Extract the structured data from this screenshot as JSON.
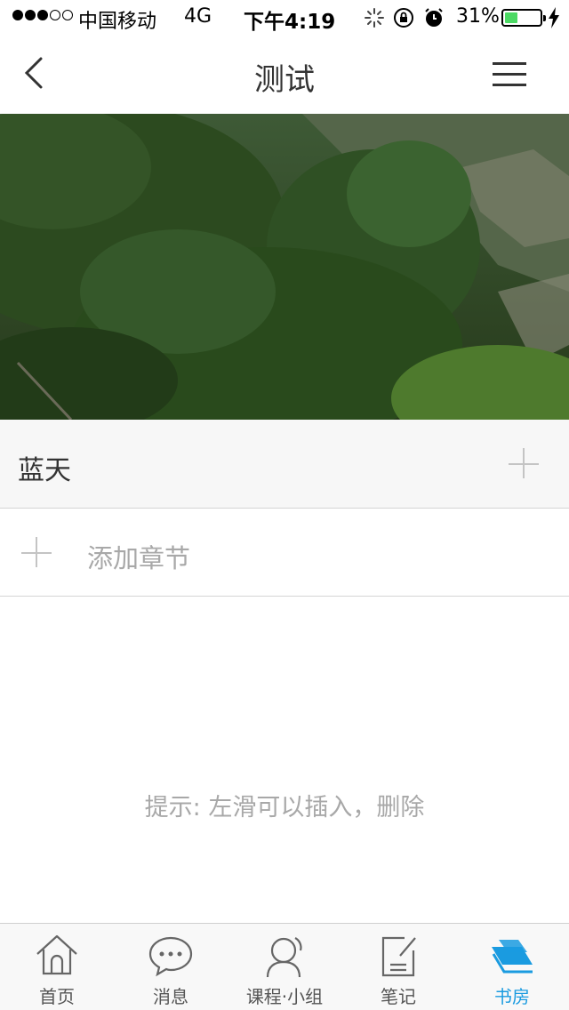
{
  "status_bar": {
    "carrier": "中国移动",
    "network": "4G",
    "time": "下午4:19",
    "battery_percent": "31%",
    "battery_level": 0.31,
    "signal_bars": 3,
    "icons": [
      "activity-spinner-icon",
      "orientation-lock-icon",
      "alarm-icon",
      "charging-bolt-icon"
    ]
  },
  "nav": {
    "title": "测试",
    "back_icon": "chevron-left-icon",
    "menu_icon": "hamburger-menu-icon"
  },
  "hero": {
    "image": "forest-hillside-photo"
  },
  "chapter": {
    "title": "蓝天",
    "add_icon": "plus-icon"
  },
  "add_section": {
    "label": "添加章节",
    "icon": "plus-icon"
  },
  "hint": "提示: 左滑可以插入，删除",
  "tabs": [
    {
      "label": "首页",
      "icon": "home-icon",
      "active": false
    },
    {
      "label": "消息",
      "icon": "chat-bubble-icon",
      "active": false
    },
    {
      "label": "课程·小组",
      "icon": "user-group-icon",
      "active": false
    },
    {
      "label": "笔记",
      "icon": "note-edit-icon",
      "active": false
    },
    {
      "label": "书房",
      "icon": "books-stack-icon",
      "active": true
    }
  ],
  "colors": {
    "accent": "#1a9be0",
    "battery_green": "#4cd964",
    "hint_gray": "#a8a8a8"
  }
}
